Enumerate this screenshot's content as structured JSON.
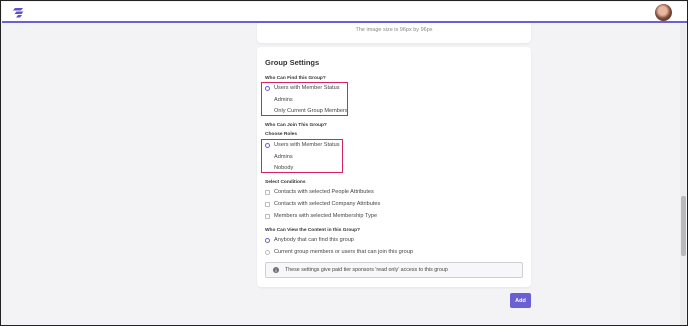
{
  "image_note": "The image size is 96px by 96px",
  "group_settings": {
    "title": "Group Settings",
    "find": {
      "label": "Who Can Find this Group?",
      "options": [
        "Users with Member Status",
        "Admins",
        "Only Current Group Members"
      ],
      "selected": "Users with Member Status"
    },
    "join": {
      "label": "Who Can Join This Group?",
      "roles_label": "Choose Roles",
      "options": [
        "Users with Member Status",
        "Admins",
        "Nobody"
      ],
      "selected": "Users with Member Status"
    },
    "conditions": {
      "label": "Select Conditions",
      "options": [
        "Contacts with selected People Attributes",
        "Contacts with selected Company Attributes",
        "Members with selected Membership Type"
      ]
    },
    "view": {
      "label": "Who Can View the Content in this Group?",
      "options": [
        "Anybody that can find this group",
        "Current group members or users that can join this group"
      ],
      "selected": "Anybody that can find this group"
    },
    "info_text": "These settings give paid tier sponsors 'read only' access to this group"
  },
  "add_label": "Add",
  "icons": {
    "logo": "logo-icon",
    "info": "info-icon",
    "avatar": "avatar"
  },
  "colors": {
    "accent": "#6b5fd6",
    "highlight": "#d6245f"
  }
}
